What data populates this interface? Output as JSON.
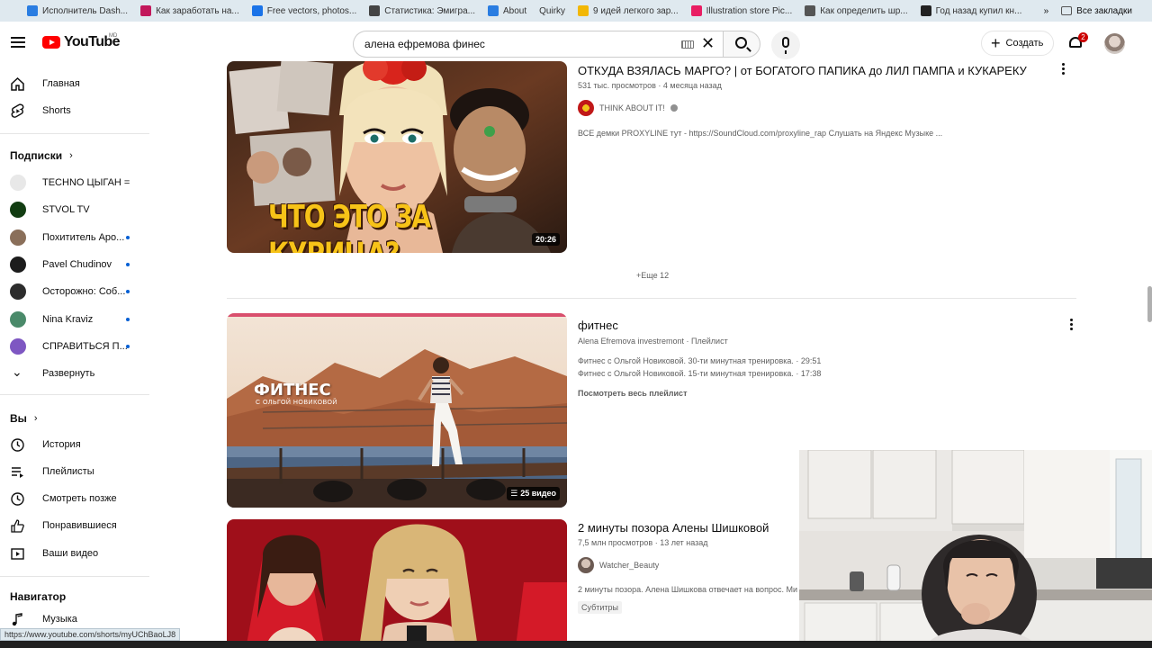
{
  "bookmarks": [
    {
      "label": "Исполнитель Dash...",
      "color": "#2a7de1"
    },
    {
      "label": "Как заработать на...",
      "color": "#c2185b"
    },
    {
      "label": "Free vectors, photos...",
      "color": "#1a73e8"
    },
    {
      "label": "Статистика: Эмигра...",
      "color": "#444444"
    },
    {
      "label": "About",
      "color": "#2a7de1"
    },
    {
      "label": "Quirky",
      "color": ""
    },
    {
      "label": "9 идей легкого зар...",
      "color": "#f2b705"
    },
    {
      "label": "Illustration store Pic...",
      "color": "#e91e63"
    },
    {
      "label": "Как определить шр...",
      "color": "#555555"
    },
    {
      "label": "Год назад купил кн...",
      "color": "#222222"
    }
  ],
  "bookmarks_more": "»",
  "bookmarks_all": "Все закладки",
  "header": {
    "logo_text": "YouTube",
    "logo_region": "MD",
    "search_value": "алена ефремова финес",
    "create_label": "Создать",
    "notification_count": "2"
  },
  "sidebar": {
    "main": [
      {
        "label": "Главная",
        "icon": "home-icon"
      },
      {
        "label": "Shorts",
        "icon": "shorts-icon"
      }
    ],
    "subscriptions_title": "Подписки",
    "subscriptions": [
      {
        "label": "TECHNO ЦЫГАН = ...",
        "avatar_color": "#e8e8e8",
        "new": false
      },
      {
        "label": "STVOL TV",
        "avatar_color": "#123d12",
        "new": false
      },
      {
        "label": "Похититель Аро...",
        "avatar_color": "#8a6f5a",
        "new": true
      },
      {
        "label": "Pavel Chudinov",
        "avatar_color": "#1c1c1c",
        "new": true
      },
      {
        "label": "Осторожно: Соб...",
        "avatar_color": "#2d2d2d",
        "new": true
      },
      {
        "label": "Nina Kraviz",
        "avatar_color": "#4a8a6a",
        "new": true
      },
      {
        "label": "СПРАВИТЬСЯ П...",
        "avatar_color": "#7e57c2",
        "new": true
      }
    ],
    "expand_label": "Развернуть",
    "you_title": "Вы",
    "you_items": [
      {
        "label": "История",
        "icon": "history-icon"
      },
      {
        "label": "Плейлисты",
        "icon": "playlists-icon"
      },
      {
        "label": "Смотреть позже",
        "icon": "watch-later-icon"
      },
      {
        "label": "Понравившиеся",
        "icon": "liked-icon"
      },
      {
        "label": "Ваши видео",
        "icon": "your-videos-icon"
      }
    ],
    "navigator_title": "Навигатор",
    "navigator_items": [
      {
        "label": "Музыка",
        "icon": "music-icon"
      }
    ]
  },
  "results": {
    "video1": {
      "title": "ОТКУДА ВЗЯЛАСЬ МАРГО? | от БОГАТОГО ПАПИКА до ЛИЛ ПАМПА и КУКАРЕКУ",
      "meta": "531 тыс. просмотров · 4 месяца назад",
      "channel": "THINK ABOUT IT!",
      "description": "ВСЕ демки PROXYLINE тут - https://SoundCloud.com/proxyline_rap Слушать на Яндекс Музыке ...",
      "thumb_caption": "ЧТО ЭТО ЗА КУРИЦА?",
      "duration": "20:26"
    },
    "more_label": "+Еще 12",
    "playlist": {
      "title": "фитнес",
      "meta": "Alena Efremova investremont · Плейлист",
      "items": [
        "Фитнес с Ольгой Новиковой. 30-ти минутная тренировка. · 29:51",
        "Фитнес с Ольгой Новиковой. 15-ти минутная тренировка. · 17:38"
      ],
      "view_all": "Посмотреть весь плейлист",
      "thumb_title": "ФИТНЕС",
      "thumb_subtitle": "С ОЛЬГОЙ НОВИКОВОЙ",
      "count": "25 видео"
    },
    "video2": {
      "title": "2 минуты позора Алены Шишковой",
      "meta": "7,5 млн просмотров · 13 лет назад",
      "channel": "Watcher_Beauty",
      "description": "2 минуты позора. Алена Шишкова отвечает на вопрос. Ми",
      "badge": "Субтитры"
    }
  },
  "status_url": "https://www.youtube.com/shorts/myUChBaoLJ8"
}
